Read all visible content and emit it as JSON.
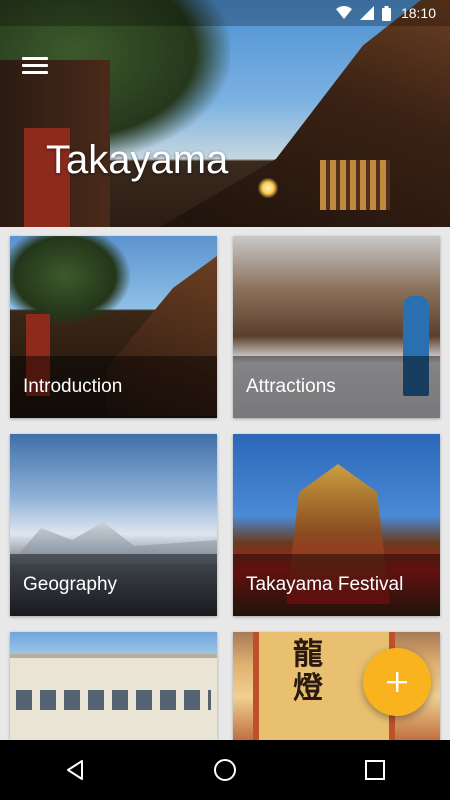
{
  "status_bar": {
    "time": "18:10",
    "icons": [
      "wifi-icon",
      "signal-icon",
      "battery-icon"
    ]
  },
  "header": {
    "title": "Takayama",
    "menu_icon": "menu-icon"
  },
  "cards": [
    {
      "label": "Introduction"
    },
    {
      "label": "Attractions"
    },
    {
      "label": "Geography"
    },
    {
      "label": "Takayama Festival"
    },
    {
      "label": ""
    },
    {
      "label": ""
    }
  ],
  "fab": {
    "icon": "plus-icon",
    "color": "#f9b31f"
  },
  "nav_bar": {
    "buttons": [
      "back-icon",
      "home-icon",
      "recents-icon"
    ]
  }
}
